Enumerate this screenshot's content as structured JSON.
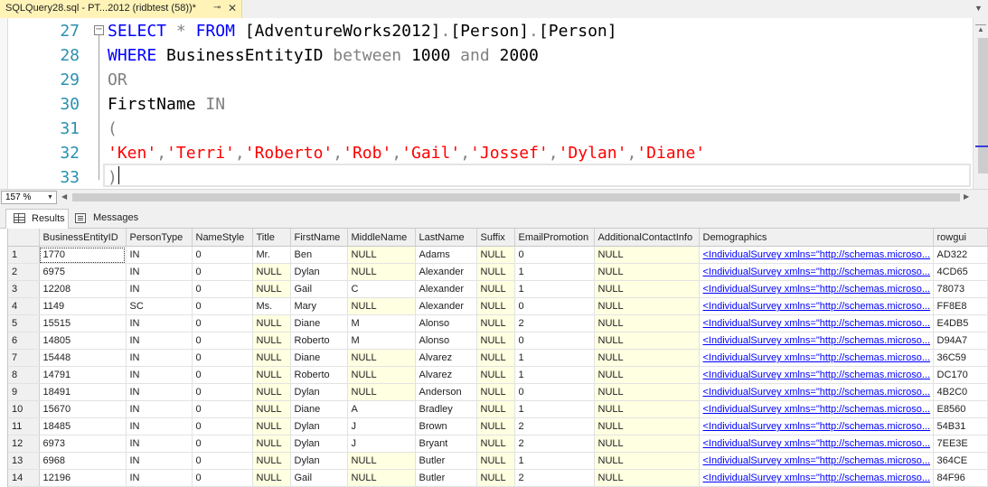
{
  "tab": {
    "title": "SQLQuery28.sql - PT...2012 (ridbtest (58))*",
    "pin_glyph": "⊸",
    "close_glyph": "✕",
    "dropdown_glyph": "▼"
  },
  "editor": {
    "lines": [
      {
        "num": "27",
        "tokens": [
          {
            "t": "SELECT",
            "c": "kw"
          },
          {
            "t": " ",
            "c": ""
          },
          {
            "t": "*",
            "c": "gr"
          },
          {
            "t": " ",
            "c": ""
          },
          {
            "t": "FROM",
            "c": "kw"
          },
          {
            "t": " [AdventureWorks2012]",
            "c": ""
          },
          {
            "t": ".",
            "c": "gr"
          },
          {
            "t": "[Person]",
            "c": ""
          },
          {
            "t": ".",
            "c": "gr"
          },
          {
            "t": "[Person]",
            "c": ""
          }
        ]
      },
      {
        "num": "28",
        "tokens": [
          {
            "t": "WHERE",
            "c": "kw"
          },
          {
            "t": " BusinessEntityID ",
            "c": ""
          },
          {
            "t": "between",
            "c": "gr"
          },
          {
            "t": " 1000 ",
            "c": ""
          },
          {
            "t": "and",
            "c": "gr"
          },
          {
            "t": " 2000",
            "c": ""
          }
        ]
      },
      {
        "num": "29",
        "tokens": [
          {
            "t": "OR",
            "c": "gr"
          }
        ]
      },
      {
        "num": "30",
        "tokens": [
          {
            "t": "FirstName ",
            "c": ""
          },
          {
            "t": "IN",
            "c": "gr"
          }
        ]
      },
      {
        "num": "31",
        "tokens": [
          {
            "t": "(",
            "c": "gr"
          }
        ]
      },
      {
        "num": "32",
        "tokens": [
          {
            "t": "'Ken'",
            "c": "str"
          },
          {
            "t": ",",
            "c": "gr"
          },
          {
            "t": "'Terri'",
            "c": "str"
          },
          {
            "t": ",",
            "c": "gr"
          },
          {
            "t": "'Roberto'",
            "c": "str"
          },
          {
            "t": ",",
            "c": "gr"
          },
          {
            "t": "'Rob'",
            "c": "str"
          },
          {
            "t": ",",
            "c": "gr"
          },
          {
            "t": "'Gail'",
            "c": "str"
          },
          {
            "t": ",",
            "c": "gr"
          },
          {
            "t": "'Jossef'",
            "c": "str"
          },
          {
            "t": ",",
            "c": "gr"
          },
          {
            "t": "'Dylan'",
            "c": "str"
          },
          {
            "t": ",",
            "c": "gr"
          },
          {
            "t": "'Diane'",
            "c": "str"
          }
        ]
      },
      {
        "num": "33",
        "tokens": [
          {
            "t": ")",
            "c": "gr"
          }
        ]
      }
    ],
    "fold_glyph": "−"
  },
  "zoom": {
    "value": "157 %",
    "dropdown_glyph": "▼"
  },
  "scroll": {
    "up": "▲",
    "left": "◀",
    "right": "▶"
  },
  "results_tabs": [
    {
      "label": "Results",
      "icon": "grid-icon",
      "active": true
    },
    {
      "label": "Messages",
      "icon": "messages-icon",
      "active": false
    }
  ],
  "grid": {
    "columns": [
      "",
      "BusinessEntityID",
      "PersonType",
      "NameStyle",
      "Title",
      "FirstName",
      "MiddleName",
      "LastName",
      "Suffix",
      "EmailPromotion",
      "AdditionalContactInfo",
      "Demographics",
      "rowgui"
    ],
    "rows": [
      [
        "1",
        "1770",
        "IN",
        "0",
        "Mr.",
        "Ben",
        "NULL",
        "Adams",
        "NULL",
        "0",
        "NULL",
        "<IndividualSurvey xmlns=\"http://schemas.microso...",
        "AD322"
      ],
      [
        "2",
        "6975",
        "IN",
        "0",
        "NULL",
        "Dylan",
        "NULL",
        "Alexander",
        "NULL",
        "1",
        "NULL",
        "<IndividualSurvey xmlns=\"http://schemas.microso...",
        "4CD65"
      ],
      [
        "3",
        "12208",
        "IN",
        "0",
        "NULL",
        "Gail",
        "C",
        "Alexander",
        "NULL",
        "1",
        "NULL",
        "<IndividualSurvey xmlns=\"http://schemas.microso...",
        "78073"
      ],
      [
        "4",
        "1149",
        "SC",
        "0",
        "Ms.",
        "Mary",
        "NULL",
        "Alexander",
        "NULL",
        "0",
        "NULL",
        "<IndividualSurvey xmlns=\"http://schemas.microso...",
        "FF8E8"
      ],
      [
        "5",
        "15515",
        "IN",
        "0",
        "NULL",
        "Diane",
        "M",
        "Alonso",
        "NULL",
        "2",
        "NULL",
        "<IndividualSurvey xmlns=\"http://schemas.microso...",
        "E4DB5"
      ],
      [
        "6",
        "14805",
        "IN",
        "0",
        "NULL",
        "Roberto",
        "M",
        "Alonso",
        "NULL",
        "0",
        "NULL",
        "<IndividualSurvey xmlns=\"http://schemas.microso...",
        "D94A7"
      ],
      [
        "7",
        "15448",
        "IN",
        "0",
        "NULL",
        "Diane",
        "NULL",
        "Alvarez",
        "NULL",
        "1",
        "NULL",
        "<IndividualSurvey xmlns=\"http://schemas.microso...",
        "36C59"
      ],
      [
        "8",
        "14791",
        "IN",
        "0",
        "NULL",
        "Roberto",
        "NULL",
        "Alvarez",
        "NULL",
        "1",
        "NULL",
        "<IndividualSurvey xmlns=\"http://schemas.microso...",
        "DC170"
      ],
      [
        "9",
        "18491",
        "IN",
        "0",
        "NULL",
        "Dylan",
        "NULL",
        "Anderson",
        "NULL",
        "0",
        "NULL",
        "<IndividualSurvey xmlns=\"http://schemas.microso...",
        "4B2C0"
      ],
      [
        "10",
        "15670",
        "IN",
        "0",
        "NULL",
        "Diane",
        "A",
        "Bradley",
        "NULL",
        "1",
        "NULL",
        "<IndividualSurvey xmlns=\"http://schemas.microso...",
        "E8560"
      ],
      [
        "11",
        "18485",
        "IN",
        "0",
        "NULL",
        "Dylan",
        "J",
        "Brown",
        "NULL",
        "2",
        "NULL",
        "<IndividualSurvey xmlns=\"http://schemas.microso...",
        "54B31"
      ],
      [
        "12",
        "6973",
        "IN",
        "0",
        "NULL",
        "Dylan",
        "J",
        "Bryant",
        "NULL",
        "2",
        "NULL",
        "<IndividualSurvey xmlns=\"http://schemas.microso...",
        "7EE3E"
      ],
      [
        "13",
        "6968",
        "IN",
        "0",
        "NULL",
        "Dylan",
        "NULL",
        "Butler",
        "NULL",
        "1",
        "NULL",
        "<IndividualSurvey xmlns=\"http://schemas.microso...",
        "364CE"
      ],
      [
        "14",
        "12196",
        "IN",
        "0",
        "NULL",
        "Gail",
        "NULL",
        "Butler",
        "NULL",
        "2",
        "NULL",
        "<IndividualSurvey xmlns=\"http://schemas.microso...",
        "84F96"
      ]
    ]
  }
}
